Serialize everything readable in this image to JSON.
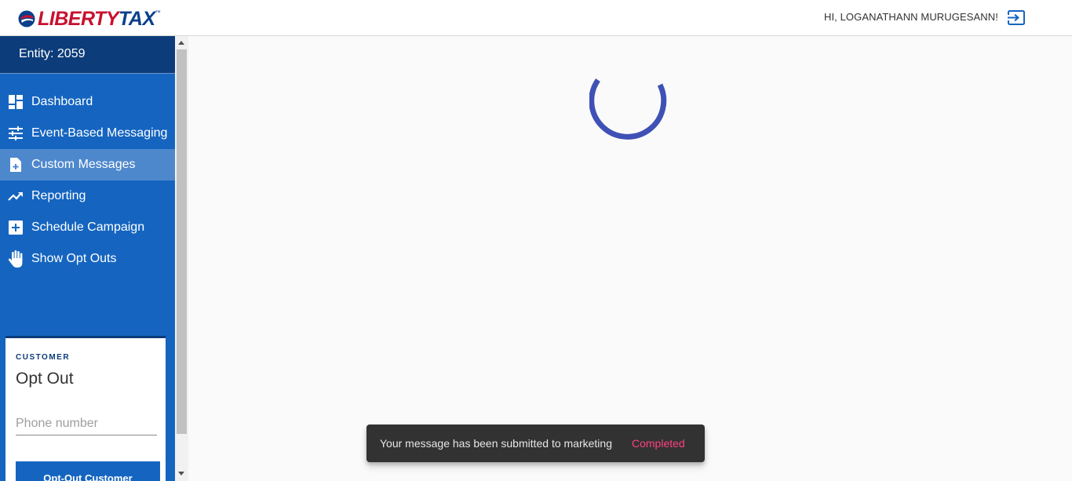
{
  "header": {
    "logo_text_part1": "LIBERTY",
    "logo_text_part2": "TAX",
    "logo_tm": "™",
    "greeting": "HI, LOGANATHANN MURUGESANN!",
    "logout_icon": "logout-icon"
  },
  "sidebar": {
    "entity": "Entity: 2059",
    "items": [
      {
        "label": "Dashboard",
        "icon": "dashboard-icon",
        "active": false
      },
      {
        "label": "Event-Based Messaging",
        "icon": "tune-icon",
        "active": false
      },
      {
        "label": "Custom Messages",
        "icon": "note-add-icon",
        "active": true
      },
      {
        "label": "Reporting",
        "icon": "trending-up-icon",
        "active": false
      },
      {
        "label": "Schedule Campaign",
        "icon": "add-box-icon",
        "active": false
      },
      {
        "label": "Show Opt Outs",
        "icon": "hand-icon",
        "active": false
      }
    ]
  },
  "optout_card": {
    "kicker": "CUSTOMER",
    "title": "Opt Out",
    "phone_placeholder": "Phone number",
    "phone_value": "",
    "button_label": "Opt-Out Customer"
  },
  "snackbar": {
    "message": "Your message has been submitted to marketing",
    "action": "Completed"
  },
  "colors": {
    "brand_blue": "#1565c0",
    "brand_dark": "#0c3c7a",
    "brand_red": "#c8102e",
    "spinner": "#3f51b5",
    "snack_action": "#ff4081"
  }
}
